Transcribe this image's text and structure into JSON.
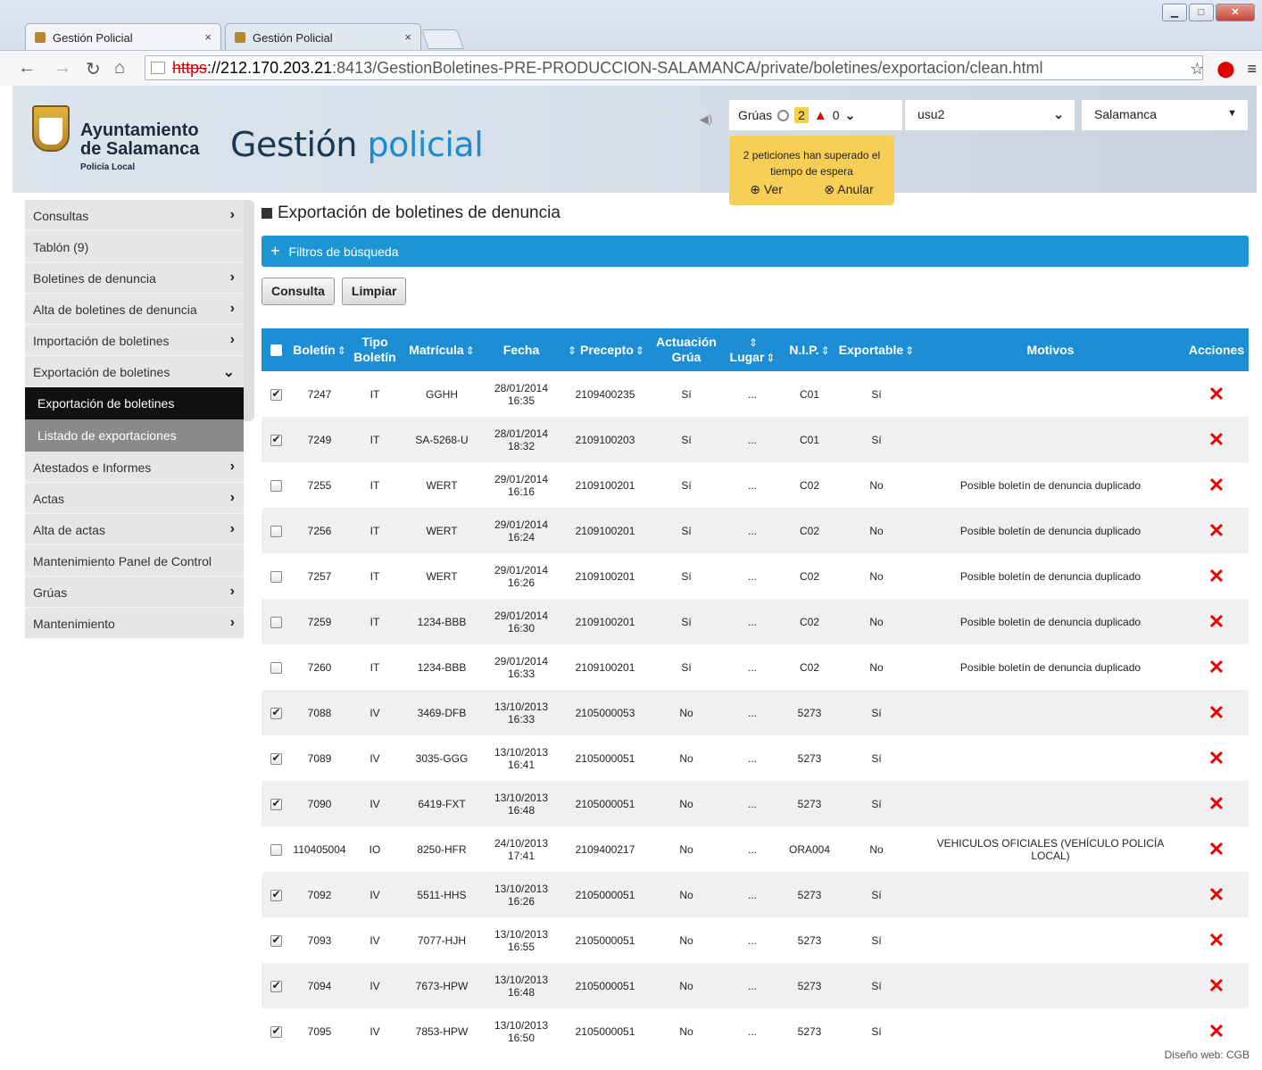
{
  "browser": {
    "tabs": [
      {
        "label": "Gestión Policial",
        "close": "×"
      },
      {
        "label": "Gestión Policial",
        "close": "×"
      }
    ],
    "url_scheme": "https",
    "url_host": "://212.170.203.21",
    "url_path": ":8413/GestionBoletines-PRE-PRODUCCION-SALAMANCA/private/boletines/exportacion/clean.html"
  },
  "header": {
    "org_line1": "Ayuntamiento",
    "org_line2": "de Salamanca",
    "org_line3": "Policía Local",
    "title_part1": "Gestión ",
    "title_part2": "policial",
    "gruas_label": "Grúas",
    "gruas_pending": "2",
    "gruas_alerts": "0",
    "user": "usu2",
    "city": "Salamanca",
    "alert_text1": "2 peticiones han superado el",
    "alert_text2": "tiempo de espera",
    "alert_ver": "Ver",
    "alert_anular": "Anular"
  },
  "sidebar": {
    "items": [
      {
        "label": "Consultas",
        "arrow": "›"
      },
      {
        "label": "Tablón (9)",
        "arrow": ""
      },
      {
        "label": "Boletines de denuncia",
        "arrow": "›"
      },
      {
        "label": "Alta de boletines de denuncia",
        "arrow": "›"
      },
      {
        "label": "Importación de boletines",
        "arrow": "›"
      },
      {
        "label": "Exportación de boletines",
        "arrow": "⌄"
      }
    ],
    "sub": [
      "Exportación de boletines",
      "Listado de exportaciones"
    ],
    "items2": [
      {
        "label": "Atestados e Informes",
        "arrow": "›"
      },
      {
        "label": "Actas",
        "arrow": "›"
      },
      {
        "label": "Alta de actas",
        "arrow": "›"
      },
      {
        "label": "Mantenimiento Panel de Control",
        "arrow": ""
      },
      {
        "label": "Grúas",
        "arrow": "›"
      },
      {
        "label": "Mantenimiento",
        "arrow": "›"
      }
    ]
  },
  "main": {
    "title": "Exportación de boletines de denuncia",
    "filters_label": "Filtros de búsqueda",
    "btn_consulta": "Consulta",
    "btn_limpiar": "Limpiar",
    "columns": {
      "boletin": "Boletín",
      "tipo1": "Tipo",
      "tipo2": "Boletín",
      "matricula": "Matrícula",
      "fecha": "Fecha",
      "precepto": "Precepto",
      "act1": "Actuación",
      "act2": "Grúa",
      "lugar": "Lugar",
      "nip": "N.I.P.",
      "exportable": "Exportable",
      "motivos": "Motivos",
      "acciones": "Acciones"
    },
    "rows": [
      {
        "checked": true,
        "boletin": "7247",
        "tipo": "IT",
        "matricula": "GGHH",
        "fecha": "28/01/2014",
        "hora": "16:35",
        "precepto": "2109400235",
        "grua": "Sí",
        "lugar": "...",
        "nip": "C01",
        "exportable": "Sí",
        "motivo": ""
      },
      {
        "checked": true,
        "boletin": "7249",
        "tipo": "IT",
        "matricula": "SA-5268-U",
        "fecha": "28/01/2014",
        "hora": "18:32",
        "precepto": "2109100203",
        "grua": "Sí",
        "lugar": "...",
        "nip": "C01",
        "exportable": "Sí",
        "motivo": ""
      },
      {
        "checked": false,
        "boletin": "7255",
        "tipo": "IT",
        "matricula": "WERT",
        "fecha": "29/01/2014",
        "hora": "16:16",
        "precepto": "2109100201",
        "grua": "Sí",
        "lugar": "...",
        "nip": "C02",
        "exportable": "No",
        "motivo": "Posible boletín de denuncia duplicado"
      },
      {
        "checked": false,
        "boletin": "7256",
        "tipo": "IT",
        "matricula": "WERT",
        "fecha": "29/01/2014",
        "hora": "16:24",
        "precepto": "2109100201",
        "grua": "Sí",
        "lugar": "...",
        "nip": "C02",
        "exportable": "No",
        "motivo": "Posible boletín de denuncia duplicado"
      },
      {
        "checked": false,
        "boletin": "7257",
        "tipo": "IT",
        "matricula": "WERT",
        "fecha": "29/01/2014",
        "hora": "16:26",
        "precepto": "2109100201",
        "grua": "Sí",
        "lugar": "...",
        "nip": "C02",
        "exportable": "No",
        "motivo": "Posible boletín de denuncia duplicado"
      },
      {
        "checked": false,
        "boletin": "7259",
        "tipo": "IT",
        "matricula": "1234-BBB",
        "fecha": "29/01/2014",
        "hora": "16:30",
        "precepto": "2109100201",
        "grua": "Sí",
        "lugar": "...",
        "nip": "C02",
        "exportable": "No",
        "motivo": "Posible boletín de denuncia duplicado"
      },
      {
        "checked": false,
        "boletin": "7260",
        "tipo": "IT",
        "matricula": "1234-BBB",
        "fecha": "29/01/2014",
        "hora": "16:33",
        "precepto": "2109100201",
        "grua": "Sí",
        "lugar": "...",
        "nip": "C02",
        "exportable": "No",
        "motivo": "Posible boletín de denuncia duplicado"
      },
      {
        "checked": true,
        "boletin": "7088",
        "tipo": "IV",
        "matricula": "3469-DFB",
        "fecha": "13/10/2013",
        "hora": "16:33",
        "precepto": "2105000053",
        "grua": "No",
        "lugar": "...",
        "nip": "5273",
        "exportable": "Sí",
        "motivo": ""
      },
      {
        "checked": true,
        "boletin": "7089",
        "tipo": "IV",
        "matricula": "3035-GGG",
        "fecha": "13/10/2013",
        "hora": "16:41",
        "precepto": "2105000051",
        "grua": "No",
        "lugar": "...",
        "nip": "5273",
        "exportable": "Sí",
        "motivo": ""
      },
      {
        "checked": true,
        "boletin": "7090",
        "tipo": "IV",
        "matricula": "6419-FXT",
        "fecha": "13/10/2013",
        "hora": "16:48",
        "precepto": "2105000051",
        "grua": "No",
        "lugar": "...",
        "nip": "5273",
        "exportable": "Sí",
        "motivo": ""
      },
      {
        "checked": false,
        "boletin": "110405004",
        "tipo": "IO",
        "matricula": "8250-HFR",
        "fecha": "24/10/2013",
        "hora": "17:41",
        "precepto": "2109400217",
        "grua": "No",
        "lugar": "...",
        "nip": "ORA004",
        "exportable": "No",
        "motivo": "VEHICULOS OFICIALES (VEHÍCULO POLICÍA LOCAL)"
      },
      {
        "checked": true,
        "boletin": "7092",
        "tipo": "IV",
        "matricula": "5511-HHS",
        "fecha": "13/10/2013",
        "hora": "16:26",
        "precepto": "2105000051",
        "grua": "No",
        "lugar": "...",
        "nip": "5273",
        "exportable": "Sí",
        "motivo": ""
      },
      {
        "checked": true,
        "boletin": "7093",
        "tipo": "IV",
        "matricula": "7077-HJH",
        "fecha": "13/10/2013",
        "hora": "16:55",
        "precepto": "2105000051",
        "grua": "No",
        "lugar": "...",
        "nip": "5273",
        "exportable": "Sí",
        "motivo": ""
      },
      {
        "checked": true,
        "boletin": "7094",
        "tipo": "IV",
        "matricula": "7673-HPW",
        "fecha": "13/10/2013",
        "hora": "16:48",
        "precepto": "2105000051",
        "grua": "No",
        "lugar": "...",
        "nip": "5273",
        "exportable": "Sí",
        "motivo": ""
      },
      {
        "checked": true,
        "boletin": "7095",
        "tipo": "IV",
        "matricula": "7853-HPW",
        "fecha": "13/10/2013",
        "hora": "16:50",
        "precepto": "2105000051",
        "grua": "No",
        "lugar": "...",
        "nip": "5273",
        "exportable": "Sí",
        "motivo": ""
      }
    ]
  },
  "footer": {
    "credit": "Diseño web: CGB"
  },
  "colors": {
    "accent": "#1e8ed4",
    "alert": "#f8cf56",
    "delete": "#ee0000"
  }
}
